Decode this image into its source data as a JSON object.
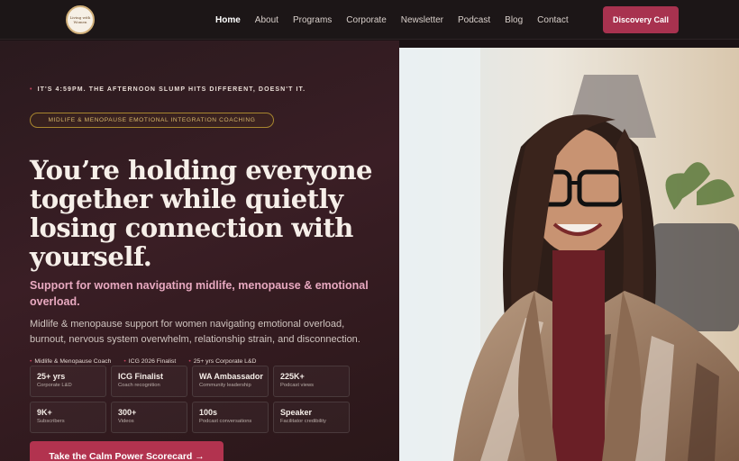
{
  "header": {
    "logo_text": "Living with Women",
    "nav": [
      {
        "label": "Home",
        "active": true
      },
      {
        "label": "About",
        "active": false
      },
      {
        "label": "Programs",
        "active": false
      },
      {
        "label": "Corporate",
        "active": false
      },
      {
        "label": "Newsletter",
        "active": false
      },
      {
        "label": "Podcast",
        "active": false
      },
      {
        "label": "Blog",
        "active": false
      },
      {
        "label": "Contact",
        "active": false
      }
    ],
    "cta_label": "Discovery Call"
  },
  "hero": {
    "kicker": "IT'S 4:59PM. THE AFTERNOON SLUMP HITS DIFFERENT, DOESN'T IT.",
    "pill": "MIDLIFE & MENOPAUSE EMOTIONAL INTEGRATION COACHING",
    "headline_lines": [
      "You’re holding everyone",
      "together while quietly",
      "losing connection with",
      "yourself."
    ],
    "subhead": "Support for women navigating midlife, menopause & emotional overload.",
    "description": "Midlife & menopause support for women navigating emotional overload, burnout, nervous system overwhelm, relationship strain, and disconnection.",
    "tags": [
      "Midlife & Menopause Coach",
      "ICG 2026 Finalist",
      "25+ yrs Corporate L&D"
    ],
    "stats": [
      {
        "value": "25+ yrs",
        "label": "Corporate L&D"
      },
      {
        "value": "ICG Finalist",
        "label": "Coach recognition"
      },
      {
        "value": "WA Ambassador",
        "label": "Community leadership"
      },
      {
        "value": "225K+",
        "label": "Podcast views"
      },
      {
        "value": "9K+",
        "label": "Subscribers"
      },
      {
        "value": "300+",
        "label": "Videos"
      },
      {
        "value": "100s",
        "label": "Podcast conversations"
      },
      {
        "value": "Speaker",
        "label": "Facilitator credibility"
      }
    ],
    "cta_label": "Take the Calm Power Scorecard →"
  },
  "colors": {
    "accent": "#a8324f",
    "pink_text": "#e8a9c0",
    "gold": "#d6b66a",
    "background": "#1a1214"
  },
  "icons": {
    "kicker_dot": "bullet-dot-icon",
    "tag_dot": "bullet-dot-icon"
  }
}
